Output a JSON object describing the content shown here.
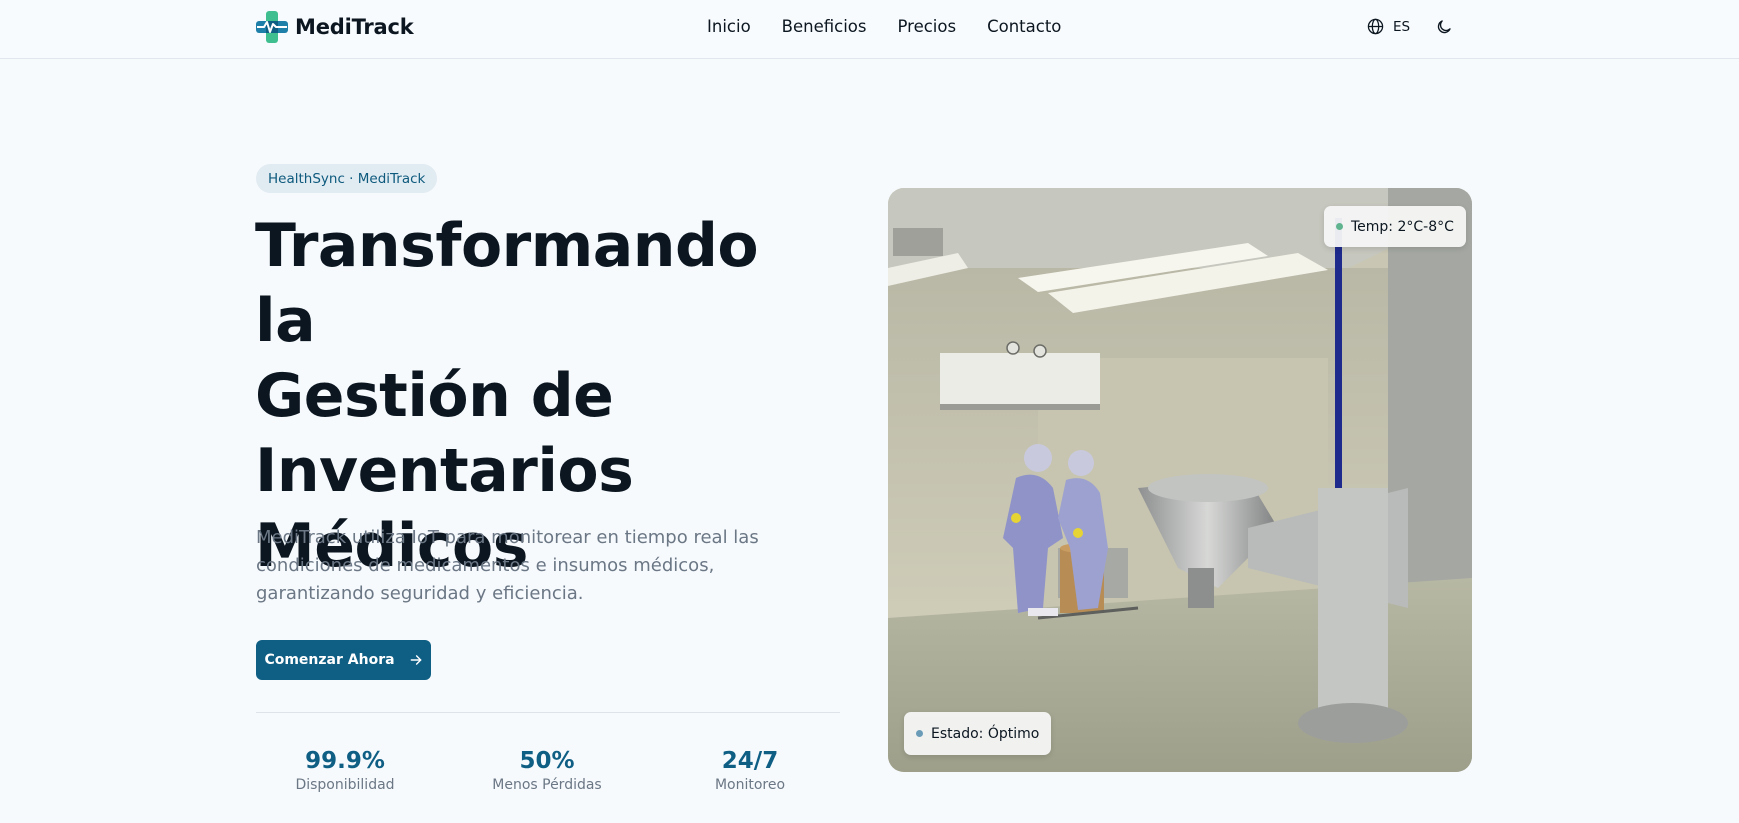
{
  "header": {
    "brand": "MediTrack",
    "nav": [
      "Inicio",
      "Beneficios",
      "Precios",
      "Contacto"
    ],
    "language": "ES",
    "icons": [
      "globe-icon",
      "moon-icon"
    ]
  },
  "hero": {
    "badge": "HealthSync · MediTrack",
    "title_lines": [
      "Transformando la",
      "Gestión de",
      "Inventarios",
      "Médicos"
    ],
    "description": "MediTrack utiliza IoT para monitorear en tiempo real las condiciones de medicamentos e insumos médicos, garantizando seguridad y eficiencia.",
    "cta_label": "Comenzar Ahora",
    "stats": [
      {
        "value": "99.9%",
        "label": "Disponibilidad"
      },
      {
        "value": "50%",
        "label": "Menos Pérdidas"
      },
      {
        "value": "24/7",
        "label": "Monitoreo"
      }
    ]
  },
  "image_card": {
    "temp_chip": "Temp: 2°C-8°C",
    "status_chip": "Estado: Óptimo",
    "temp_dot_color": "#5fb38f",
    "status_dot_color": "#6a9cb8"
  },
  "colors": {
    "primary": "#0f5e84",
    "background": "#f6fafd",
    "badge_bg": "#e1ebf2"
  }
}
